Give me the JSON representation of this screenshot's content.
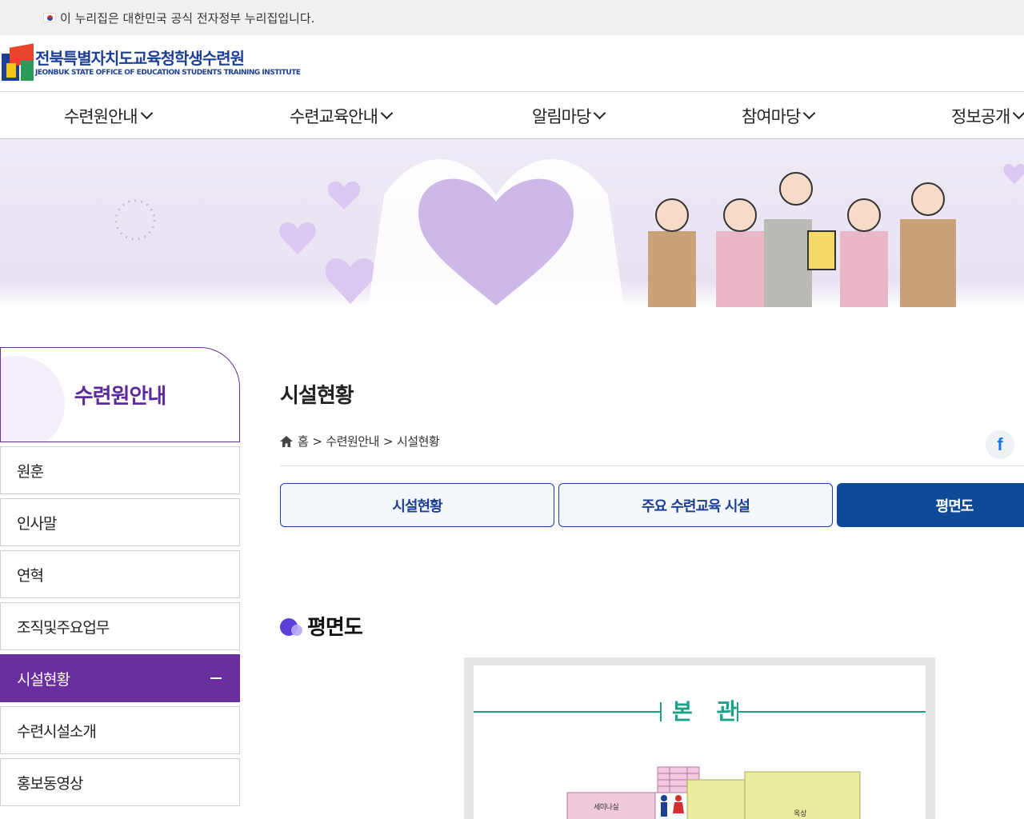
{
  "gov_bar": {
    "text": "이 누리집은 대한민국 공식 전자정부 누리집입니다."
  },
  "logo": {
    "name_ko": "전북특별자치도교육청학생수련원",
    "name_en": "JEONBUK STATE OFFICE OF EDUCATION STUDENTS TRAINING INSTITUTE"
  },
  "gnb": {
    "items": [
      {
        "label": "수련원안내"
      },
      {
        "label": "수련교육안내"
      },
      {
        "label": "알림마당"
      },
      {
        "label": "참여마당"
      },
      {
        "label": "정보공개"
      }
    ]
  },
  "lnb": {
    "title": "수련원안내",
    "items": [
      {
        "label": "원훈"
      },
      {
        "label": "인사말"
      },
      {
        "label": "연혁"
      },
      {
        "label": "조직및주요업무"
      },
      {
        "label": "시설현황",
        "active": true
      },
      {
        "label": "수련시설소개"
      },
      {
        "label": "홍보동영상"
      }
    ]
  },
  "page": {
    "title": "시설현황",
    "breadcrumb": {
      "home": "홈",
      "sep": ">",
      "level1": "수련원안내",
      "level2": "시설현황"
    },
    "share": {
      "facebook": "f"
    },
    "tabs": [
      {
        "label": "시설현황"
      },
      {
        "label": "주요 수련교육 시설"
      },
      {
        "label": "평면도",
        "active": true
      }
    ],
    "section_title": "평면도"
  },
  "floorplan": {
    "building": "본 관",
    "rooms": [
      {
        "label": "세미나실"
      },
      {
        "label": "옥상"
      }
    ]
  },
  "colors": {
    "brand_blue": "#1c3f94",
    "lnb_purple": "#6a2e9e",
    "tab_active": "#0f4a99",
    "teal": "#1ba28b"
  }
}
